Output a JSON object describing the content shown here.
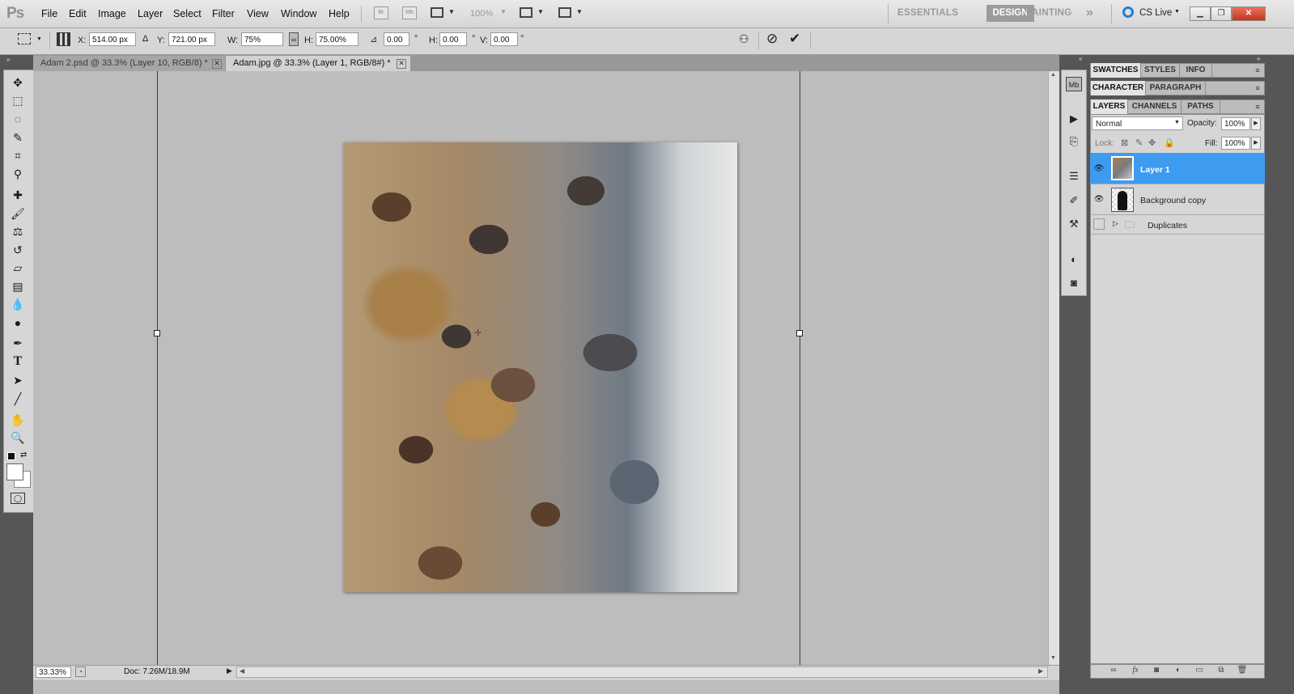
{
  "app": {
    "logo": "Ps",
    "menus": [
      "File",
      "Edit",
      "Image",
      "Layer",
      "Select",
      "Filter",
      "View",
      "Window",
      "Help"
    ],
    "bridge_icon": "Br",
    "minibridge_icon": "Mb",
    "zoom_level": "100%",
    "workspaces": [
      "ESSENTIALS",
      "DESIGN",
      "PAINTING"
    ],
    "more_workspaces": "»",
    "cs_live": "CS Live",
    "accent_color": "#3d9bf0"
  },
  "options": {
    "x_label": "X:",
    "x_value": "514.00 px",
    "y_label": "Y:",
    "y_value": "721.00 px",
    "w_label": "W:",
    "w_value": "75%",
    "h_label": "H:",
    "h_value": "75.00%",
    "angle_value": "0.00",
    "angle_unit": "°",
    "hskew_label": "H:",
    "hskew_value": "0.00",
    "hskew_unit": "°",
    "vskew_label": "V:",
    "vskew_value": "0.00",
    "vskew_unit": "°"
  },
  "tabs": [
    {
      "label": "Adam 2.psd @ 33.3% (Layer 10, RGB/8) *",
      "active": false
    },
    {
      "label": "Adam.jpg @ 33.3% (Layer 1, RGB/8#) *",
      "active": true
    }
  ],
  "status": {
    "zoom": "33.33%",
    "doc": "Doc: 7.26M/18.9M"
  },
  "panels": {
    "group1_tabs": [
      "SWATCHES",
      "STYLES",
      "INFO"
    ],
    "group2_tabs": [
      "CHARACTER",
      "PARAGRAPH"
    ],
    "group3_tabs": [
      "LAYERS",
      "CHANNELS",
      "PATHS"
    ]
  },
  "layers": {
    "blend_mode": "Normal",
    "opacity_label": "Opacity:",
    "opacity": "100%",
    "lock_label": "Lock:",
    "fill_label": "Fill:",
    "fill": "100%",
    "items": [
      {
        "name": "Layer 1",
        "selected": true,
        "visible": true
      },
      {
        "name": "Background copy",
        "selected": false,
        "visible": true
      },
      {
        "name": "Duplicates",
        "selected": false,
        "visible": false,
        "group": true
      }
    ]
  }
}
